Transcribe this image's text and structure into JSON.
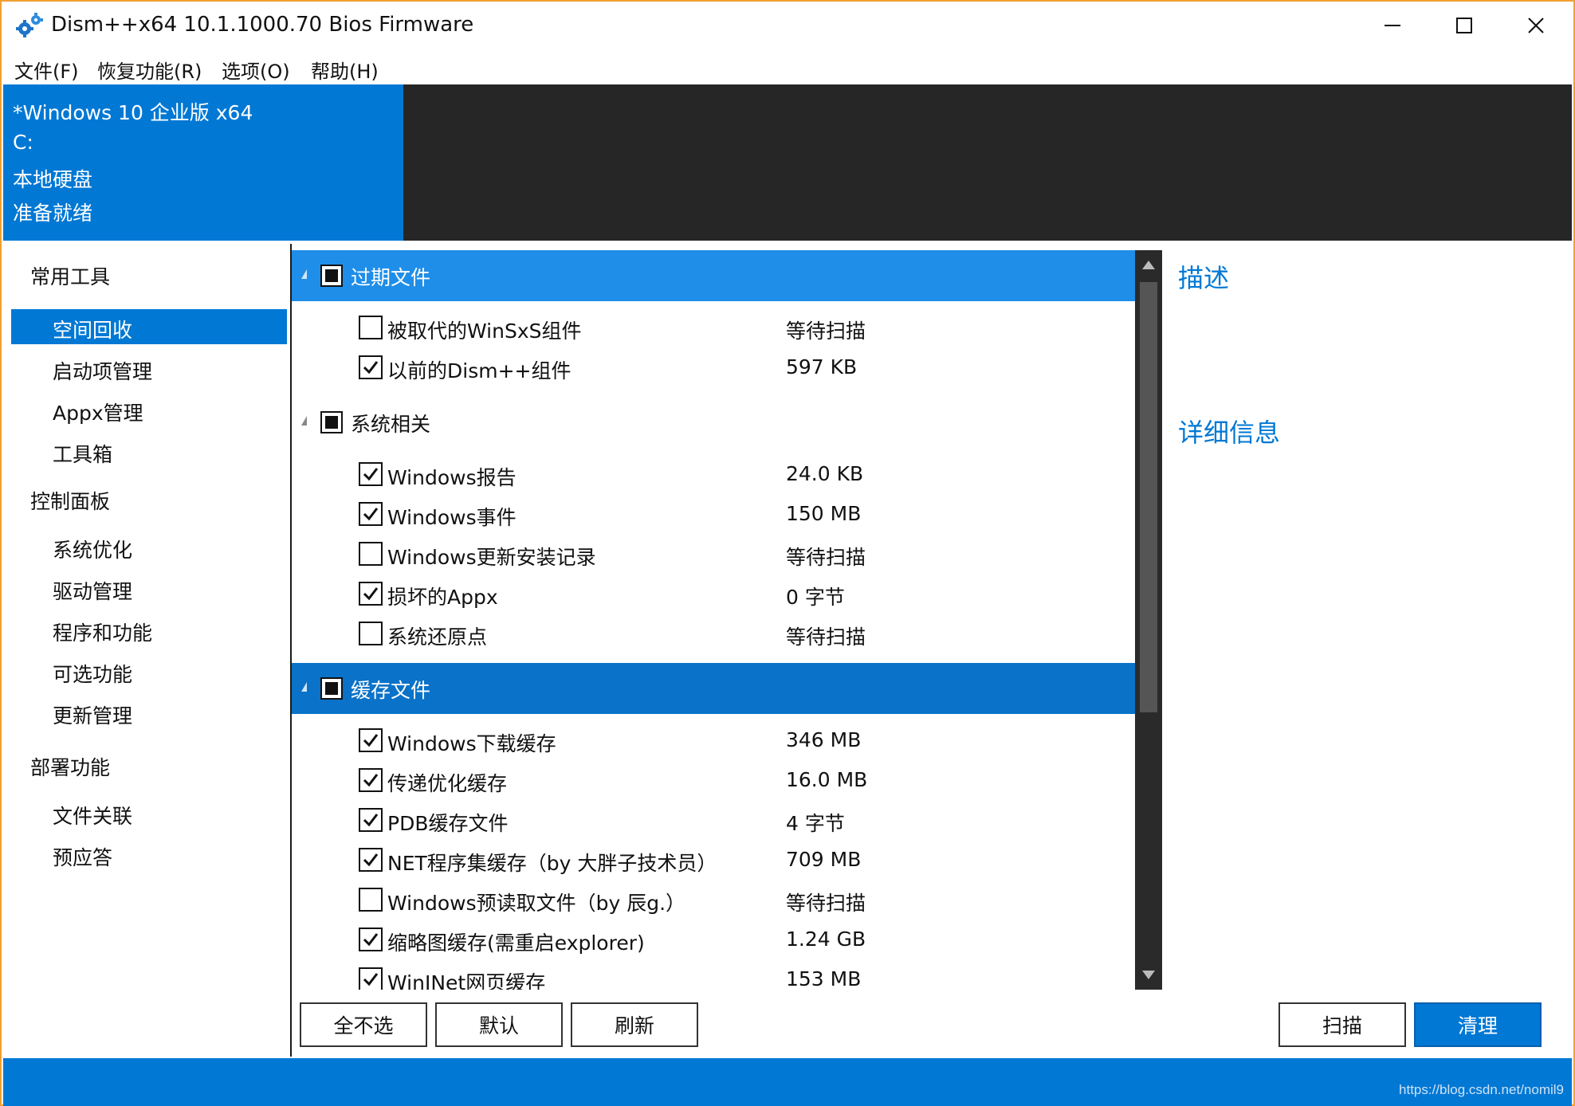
{
  "window": {
    "title": "Dism++x64 10.1.1000.70 Bios Firmware"
  },
  "menu": [
    "文件(F)",
    "恢复功能(R)",
    "选项(O)",
    "帮助(H)"
  ],
  "header": {
    "os": "*Windows 10 企业版 x64",
    "drive": "C:",
    "disk": "本地硬盘",
    "status": "准备就绪"
  },
  "nav": {
    "categories": [
      {
        "label": "常用工具",
        "items": [
          "空间回收",
          "启动项管理",
          "Appx管理",
          "工具箱"
        ]
      },
      {
        "label": "控制面板",
        "items": [
          "系统优化",
          "驱动管理",
          "程序和功能",
          "可选功能",
          "更新管理"
        ]
      },
      {
        "label": "部署功能",
        "items": [
          "文件关联",
          "预应答"
        ]
      }
    ],
    "selected": "空间回收"
  },
  "list": {
    "groups": [
      {
        "label": "过期文件",
        "items": [
          {
            "label": "被取代的WinSxS组件",
            "size": "等待扫描",
            "checked": false
          },
          {
            "label": "以前的Dism++组件",
            "size": "597 KB",
            "checked": true
          }
        ]
      },
      {
        "label": "系统相关",
        "items": [
          {
            "label": "Windows报告",
            "size": "24.0 KB",
            "checked": true
          },
          {
            "label": "Windows事件",
            "size": "150 MB",
            "checked": true
          },
          {
            "label": "Windows更新安装记录",
            "size": "等待扫描",
            "checked": false
          },
          {
            "label": "损坏的Appx",
            "size": "0 字节",
            "checked": true
          },
          {
            "label": "系统还原点",
            "size": "等待扫描",
            "checked": false
          }
        ]
      },
      {
        "label": "缓存文件",
        "items": [
          {
            "label": "Windows下载缓存",
            "size": "346 MB",
            "checked": true
          },
          {
            "label": "传递优化缓存",
            "size": "16.0 MB",
            "checked": true
          },
          {
            "label": "PDB缓存文件",
            "size": "4 字节",
            "checked": true
          },
          {
            "label": "NET程序集缓存（by 大胖子技术员）",
            "size": "709 MB",
            "checked": true
          },
          {
            "label": "Windows预读取文件（by 辰g.）",
            "size": "等待扫描",
            "checked": false
          },
          {
            "label": "缩略图缓存(需重启explorer)",
            "size": "1.24 GB",
            "checked": true
          },
          {
            "label": "WinINet网页缓存",
            "size": "153 MB",
            "checked": true
          }
        ]
      }
    ]
  },
  "right": {
    "description_title": "描述",
    "detail_title": "详细信息"
  },
  "buttons": {
    "deselect_all": "全不选",
    "default": "默认",
    "refresh": "刷新",
    "scan": "扫描",
    "clean": "清理"
  },
  "statusbar": {
    "watermark": "https://blog.csdn.net/nomil9"
  },
  "colors": {
    "accent": "#0078d4",
    "header_dark": "#262626",
    "group_highlight": "#1f8ee8"
  }
}
